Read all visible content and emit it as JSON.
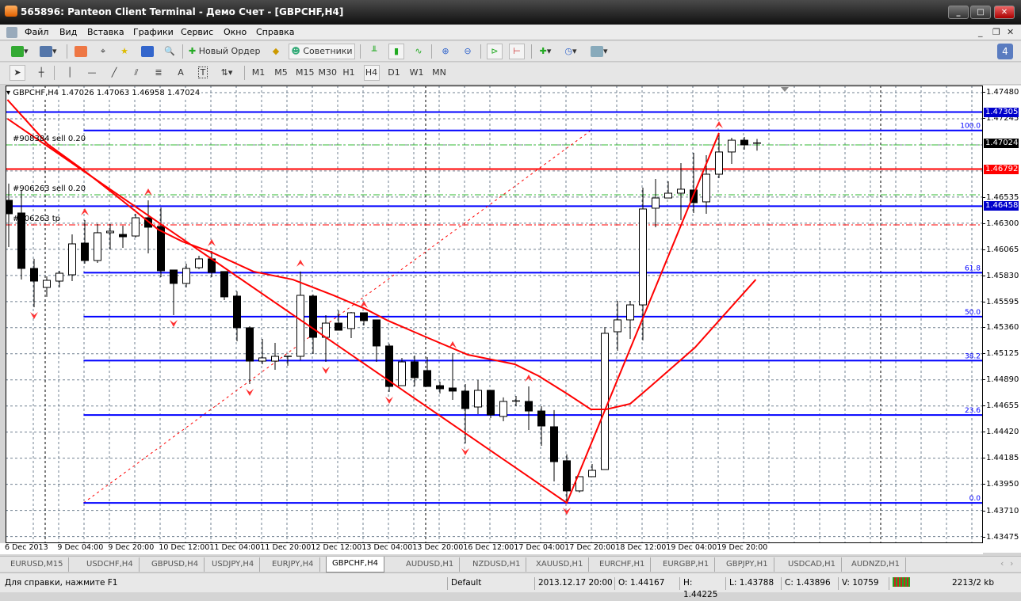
{
  "window": {
    "title": "565896: Panteon Client Terminal - Демо Счет - [GBPCHF,H4]"
  },
  "menu": [
    "Файл",
    "Вид",
    "Вставка",
    "Графики",
    "Сервис",
    "Окно",
    "Справка"
  ],
  "toolbar": {
    "new_order": "Новый Ордер",
    "experts": "Советники",
    "notifications": "4"
  },
  "drawing_tools": {
    "text_label": "A",
    "text_box": "T"
  },
  "timeframes": [
    "M1",
    "M5",
    "M15",
    "M30",
    "H1",
    "H4",
    "D1",
    "W1",
    "MN"
  ],
  "active_timeframe": "H4",
  "chart": {
    "info": "GBPCHF,H4  1.47026 1.47063 1.46958 1.47024",
    "symbol": "GBPCHF",
    "colors": {
      "bull": "#ffffff",
      "bear": "#000000",
      "level": "#0000ff",
      "indicator": "#ff0000",
      "trade": "#33bb33",
      "grid": "#708090"
    },
    "price_ticks": [
      "1.47480",
      "1.47245",
      "1.46535",
      "1.46300",
      "1.46065",
      "1.45830",
      "1.45595",
      "1.45360",
      "1.45125",
      "1.44890",
      "1.44655",
      "1.44420",
      "1.44185",
      "1.43950",
      "1.43710",
      "1.43475"
    ],
    "price_labels": [
      {
        "text": "1.47305",
        "price": 1.47305,
        "color": "#0000cc"
      },
      {
        "text": "1.47024",
        "price": 1.47024,
        "color": "#000000"
      },
      {
        "text": "1.46792",
        "price": 1.46792,
        "color": "#ff0000"
      },
      {
        "text": "1.46458",
        "price": 1.46458,
        "color": "#0000cc"
      }
    ],
    "time_labels": [
      "6 Dec 2013",
      "9 Dec 04:00",
      "9 Dec 20:00",
      "10 Dec 12:00",
      "11 Dec 04:00",
      "11 Dec 20:00",
      "12 Dec 12:00",
      "13 Dec 04:00",
      "13 Dec 20:00",
      "16 Dec 12:00",
      "17 Dec 04:00",
      "17 Dec 20:00",
      "18 Dec 12:00",
      "19 Dec 04:00",
      "19 Dec 20:00"
    ],
    "horizontal_lines": [
      {
        "price": 1.47305,
        "color": "#0000ff"
      },
      {
        "price": 1.46792,
        "color": "#ff0000"
      },
      {
        "price": 1.46458,
        "color": "#0000ff"
      }
    ],
    "trade_lines": [
      {
        "label": "#908384 sell 0.20",
        "price": 1.4701,
        "color": "#33bb33"
      },
      {
        "label": "#906263 sell 0.20",
        "price": 1.46561,
        "color": "#33bb33"
      },
      {
        "label": "#906263 tp",
        "price": 1.4629,
        "color": "#ff0000"
      }
    ],
    "fibonacci": {
      "start_bar": 5.9,
      "end_bar": 45.9,
      "low": 1.43788,
      "high": 1.4714,
      "levels": [
        {
          "label": "100.0",
          "ratio": 1.0
        },
        {
          "label": "61.8",
          "ratio": 0.618
        },
        {
          "label": "50.0",
          "ratio": 0.5
        },
        {
          "label": "38.2",
          "ratio": 0.382
        },
        {
          "label": "23.6",
          "ratio": 0.236
        },
        {
          "label": "0.0",
          "ratio": 0.0
        }
      ]
    },
    "zigzag": [
      [
        -0.1,
        1.47245
      ],
      [
        44,
        1.43788
      ],
      [
        56,
        1.47117
      ]
    ],
    "moving_average": [
      [
        -0.1,
        1.47416
      ],
      [
        3.06,
        1.47017
      ],
      [
        5.9,
        1.46782
      ],
      [
        8.7,
        1.46532
      ],
      [
        11.8,
        1.46247
      ],
      [
        13.7,
        1.4614
      ],
      [
        15.9,
        1.46048
      ],
      [
        19.3,
        1.4587
      ],
      [
        22.4,
        1.45798
      ],
      [
        25.6,
        1.45656
      ],
      [
        28.1,
        1.45535
      ],
      [
        29.9,
        1.45428
      ],
      [
        33.1,
        1.45271
      ],
      [
        36.2,
        1.45121
      ],
      [
        39.9,
        1.45036
      ],
      [
        41.8,
        1.44929
      ],
      [
        44,
        1.44772
      ],
      [
        45.9,
        1.4463
      ],
      [
        47.1,
        1.4463
      ],
      [
        49,
        1.4468
      ],
      [
        50.6,
        1.44836
      ],
      [
        54.1,
        1.45185
      ],
      [
        58.9,
        1.45798
      ]
    ],
    "fractals_up": [
      6,
      11,
      16,
      23,
      28,
      35,
      41,
      56
    ],
    "fractals_down": [
      2,
      13,
      19,
      25,
      30,
      36,
      44
    ],
    "candles_ohlc": [
      [
        1.46511,
        1.46661,
        1.4609,
        1.4639
      ],
      [
        1.46397,
        1.46604,
        1.45798,
        1.45898
      ],
      [
        1.45898,
        1.45984,
        1.45549,
        1.45784
      ],
      [
        1.45727,
        1.45827,
        1.45642,
        1.45791
      ],
      [
        1.45784,
        1.45877,
        1.45727,
        1.45855
      ],
      [
        1.45841,
        1.46204,
        1.45784,
        1.46119
      ],
      [
        1.46126,
        1.46333,
        1.45941,
        1.45969
      ],
      [
        1.45969,
        1.46297,
        1.45948,
        1.46219
      ],
      [
        1.46219,
        1.46297,
        1.46069,
        1.46233
      ],
      [
        1.46204,
        1.46283,
        1.46083,
        1.46183
      ],
      [
        1.4619,
        1.4639,
        1.46176,
        1.46354
      ],
      [
        1.46354,
        1.46511,
        1.46033,
        1.46269
      ],
      [
        1.46276,
        1.46447,
        1.4582,
        1.45877
      ],
      [
        1.45884,
        1.45884,
        1.45478,
        1.45763
      ],
      [
        1.45763,
        1.45941,
        1.45727,
        1.45898
      ],
      [
        1.45905,
        1.46012,
        1.45891,
        1.45984
      ],
      [
        1.45984,
        1.46055,
        1.4582,
        1.45862
      ],
      [
        1.4587,
        1.4587,
        1.45613,
        1.45642
      ],
      [
        1.45649,
        1.45691,
        1.45242,
        1.45364
      ],
      [
        1.45364,
        1.45378,
        1.44858,
        1.45064
      ],
      [
        1.45064,
        1.45264,
        1.45036,
        1.45093
      ],
      [
        1.45064,
        1.45228,
        1.44986,
        1.45107
      ],
      [
        1.45107,
        1.45107,
        1.45022,
        1.451
      ],
      [
        1.45107,
        1.4587,
        1.45071,
        1.45656
      ],
      [
        1.45649,
        1.45663,
        1.45128,
        1.45278
      ],
      [
        1.45278,
        1.45478,
        1.45057,
        1.45406
      ],
      [
        1.45406,
        1.4552,
        1.45342,
        1.45342
      ],
      [
        1.45357,
        1.45506,
        1.45271,
        1.45499
      ],
      [
        1.45499,
        1.45499,
        1.45385,
        1.45428
      ],
      [
        1.45435,
        1.45435,
        1.45057,
        1.452
      ],
      [
        1.452,
        1.45221,
        1.44786,
        1.44836
      ],
      [
        1.44843,
        1.45093,
        1.44843,
        1.45057
      ],
      [
        1.45057,
        1.45114,
        1.44836,
        1.44915
      ],
      [
        1.44979,
        1.451,
        1.44836,
        1.44836
      ],
      [
        1.44843,
        1.44879,
        1.44772,
        1.44815
      ],
      [
        1.44822,
        1.45136,
        1.44715,
        1.44794
      ],
      [
        1.44794,
        1.44858,
        1.44323,
        1.44637
      ],
      [
        1.44651,
        1.44893,
        1.44587,
        1.44801
      ],
      [
        1.44801,
        1.44801,
        1.44551,
        1.4458
      ],
      [
        1.44566,
        1.44737,
        1.44523,
        1.44701
      ],
      [
        1.44701,
        1.44751,
        1.44658,
        1.44705
      ],
      [
        1.44701,
        1.44836,
        1.44444,
        1.44615
      ],
      [
        1.44615,
        1.44658,
        1.44302,
        1.4448
      ],
      [
        1.44473,
        1.44623,
        1.43981,
        1.44159
      ],
      [
        1.44167,
        1.44225,
        1.43788,
        1.43896
      ],
      [
        1.43896,
        1.44024,
        1.43881,
        1.44024
      ],
      [
        1.44024,
        1.44138,
        1.44024,
        1.44081
      ],
      [
        1.44088,
        1.45371,
        1.44088,
        1.45314
      ],
      [
        1.45328,
        1.45606,
        1.45157,
        1.45435
      ],
      [
        1.45435,
        1.45606,
        1.45264,
        1.4557
      ],
      [
        1.4557,
        1.46625,
        1.4525,
        1.46433
      ],
      [
        1.4644,
        1.46703,
        1.46269,
        1.46532
      ],
      [
        1.46532,
        1.46682,
        1.46532,
        1.46575
      ],
      [
        1.46575,
        1.46846,
        1.46333,
        1.46611
      ],
      [
        1.46604,
        1.46938,
        1.46397,
        1.4649
      ],
      [
        1.46497,
        1.46917,
        1.4639,
        1.46746
      ],
      [
        1.46746,
        1.47117,
        1.4671,
        1.46946
      ],
      [
        1.46946,
        1.47074,
        1.46839,
        1.47052
      ],
      [
        1.47052,
        1.47081,
        1.46967,
        1.4701
      ],
      [
        1.47026,
        1.47063,
        1.46958,
        1.47024
      ]
    ]
  },
  "tabs": [
    "EURUSD,M15",
    "USDCHF,H4",
    "GBPUSD,H4",
    "USDJPY,H4",
    "EURJPY,H4",
    "GBPCHF,H4",
    "AUDUSD,H1",
    "NZDUSD,H1",
    "XAUUSD,H1",
    "EURCHF,H1",
    "EURGBP,H1",
    "GBPJPY,H1",
    "USDCAD,H1",
    "AUDNZD,H1"
  ],
  "active_tab": "GBPCHF,H4",
  "status": {
    "help": "Для справки, нажмите F1",
    "profile": "Default",
    "time": "2013.12.17 20:00",
    "open": "O: 1.44167",
    "high": "H: 1.44225",
    "low": "L: 1.43788",
    "close": "C: 1.43896",
    "volume": "V: 10759",
    "traffic": "2213/2 kb"
  }
}
